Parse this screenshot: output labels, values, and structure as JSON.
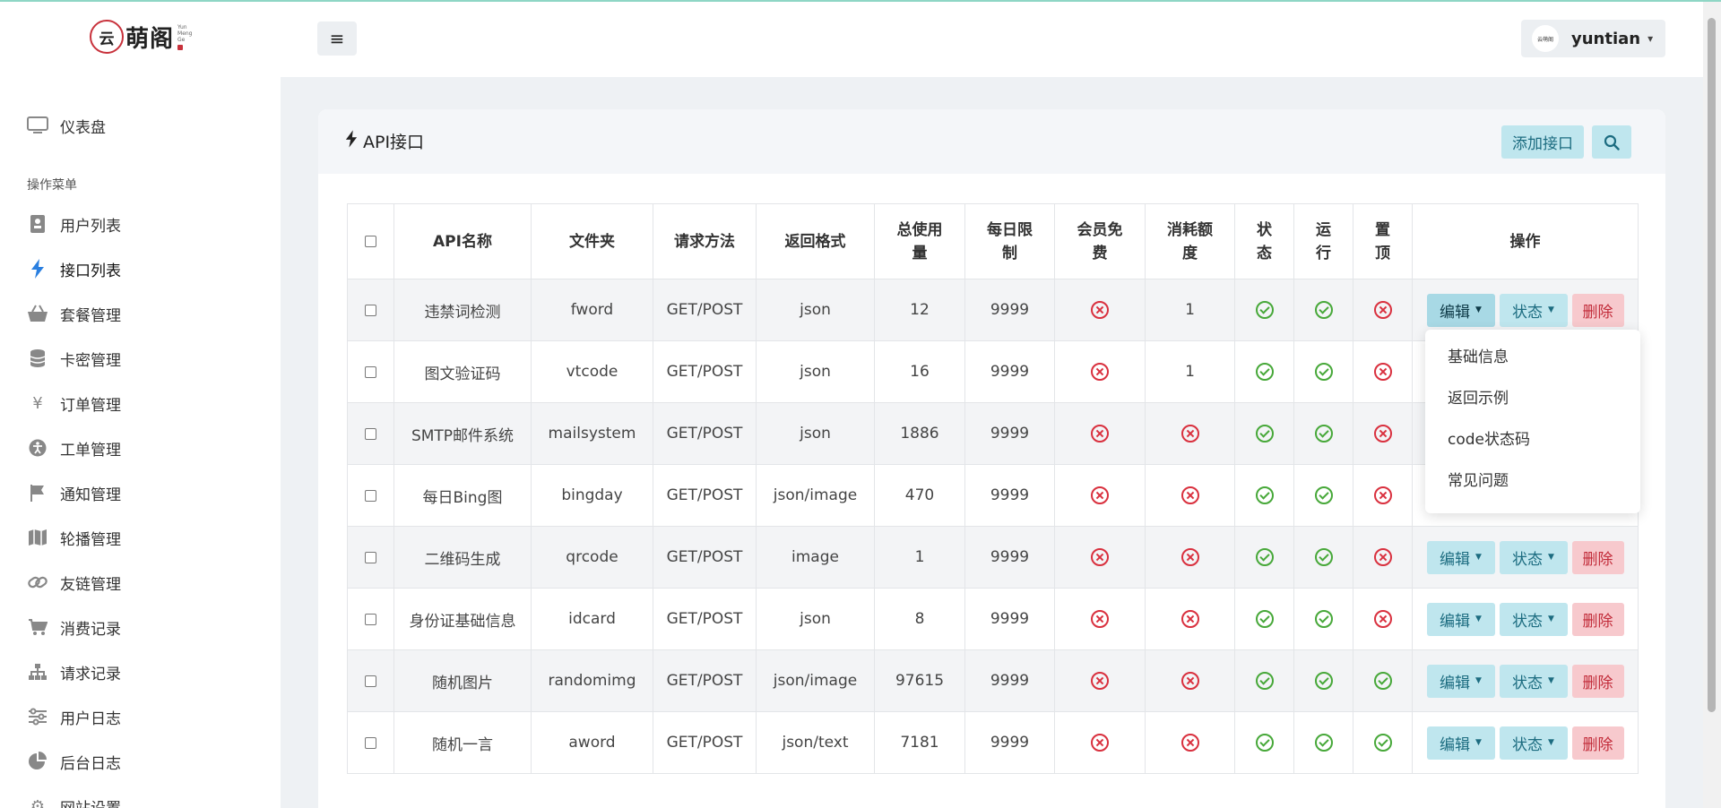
{
  "brand": {
    "mark": "云",
    "name": "萌阁",
    "sub": [
      "Yun",
      "Meng",
      "Ge"
    ]
  },
  "header": {
    "username": "yuntian",
    "avatar_text": "云萌阁"
  },
  "sidebar": {
    "section_label": "操作菜单",
    "dashboard": "仪表盘",
    "items": [
      {
        "label": "用户列表",
        "icon": "id-card-icon"
      },
      {
        "label": "接口列表",
        "icon": "bolt-icon",
        "active": true
      },
      {
        "label": "套餐管理",
        "icon": "basket-icon"
      },
      {
        "label": "卡密管理",
        "icon": "database-icon"
      },
      {
        "label": "订单管理",
        "icon": "yen-icon"
      },
      {
        "label": "工单管理",
        "icon": "accessibility-icon"
      },
      {
        "label": "通知管理",
        "icon": "flag-icon"
      },
      {
        "label": "轮播管理",
        "icon": "map-icon"
      },
      {
        "label": "友链管理",
        "icon": "link-icon"
      },
      {
        "label": "消费记录",
        "icon": "cart-icon"
      },
      {
        "label": "请求记录",
        "icon": "sitemap-icon"
      },
      {
        "label": "用户日志",
        "icon": "sliders-icon"
      },
      {
        "label": "后台日志",
        "icon": "pie-chart-icon"
      },
      {
        "label": "网站设置",
        "icon": "gear-icon"
      }
    ]
  },
  "card": {
    "title": "API接口",
    "add_label": "添加接口"
  },
  "table": {
    "headers": [
      "API名称",
      "文件夹",
      "请求方法",
      "返回格式",
      "总使用量",
      "每日限制",
      "会员免费",
      "消耗额度",
      "状态",
      "运行",
      "置顶",
      "操作"
    ],
    "rows": [
      {
        "name": "违禁词检测",
        "folder": "fword",
        "method": "GET/POST",
        "format": "json",
        "total": "12",
        "daily": "9999",
        "vip_free": false,
        "cost": "1",
        "status": true,
        "running": true,
        "top": false
      },
      {
        "name": "图文验证码",
        "folder": "vtcode",
        "method": "GET/POST",
        "format": "json",
        "total": "16",
        "daily": "9999",
        "vip_free": false,
        "cost": "1",
        "status": true,
        "running": true,
        "top": false
      },
      {
        "name": "SMTP邮件系统",
        "folder": "mailsystem",
        "method": "GET/POST",
        "format": "json",
        "total": "1886",
        "daily": "9999",
        "vip_free": false,
        "cost": false,
        "status": true,
        "running": true,
        "top": false
      },
      {
        "name": "每日Bing图",
        "folder": "bingday",
        "method": "GET/POST",
        "format": "json/image",
        "total": "470",
        "daily": "9999",
        "vip_free": false,
        "cost": false,
        "status": true,
        "running": true,
        "top": false
      },
      {
        "name": "二维码生成",
        "folder": "qrcode",
        "method": "GET/POST",
        "format": "image",
        "total": "1",
        "daily": "9999",
        "vip_free": false,
        "cost": false,
        "status": true,
        "running": true,
        "top": false
      },
      {
        "name": "身份证基础信息",
        "folder": "idcard",
        "method": "GET/POST",
        "format": "json",
        "total": "8",
        "daily": "9999",
        "vip_free": false,
        "cost": false,
        "status": true,
        "running": true,
        "top": false
      },
      {
        "name": "随机图片",
        "folder": "randomimg",
        "method": "GET/POST",
        "format": "json/image",
        "total": "97615",
        "daily": "9999",
        "vip_free": false,
        "cost": false,
        "status": true,
        "running": true,
        "top": true
      },
      {
        "name": "随机一言",
        "folder": "aword",
        "method": "GET/POST",
        "format": "json/text",
        "total": "7181",
        "daily": "9999",
        "vip_free": false,
        "cost": false,
        "status": true,
        "running": true,
        "top": true
      }
    ],
    "actions": {
      "edit": "编辑",
      "state": "状态",
      "delete": "删除"
    }
  },
  "dropdown": {
    "items": [
      "基础信息",
      "返回示例",
      "code状态码",
      "常见问题"
    ]
  },
  "colors": {
    "ok": "#47a839",
    "no": "#d9303e",
    "info_bg": "#bfe6ee",
    "danger_bg": "#f7c9cd",
    "active_icon": "#2a7fe0"
  }
}
